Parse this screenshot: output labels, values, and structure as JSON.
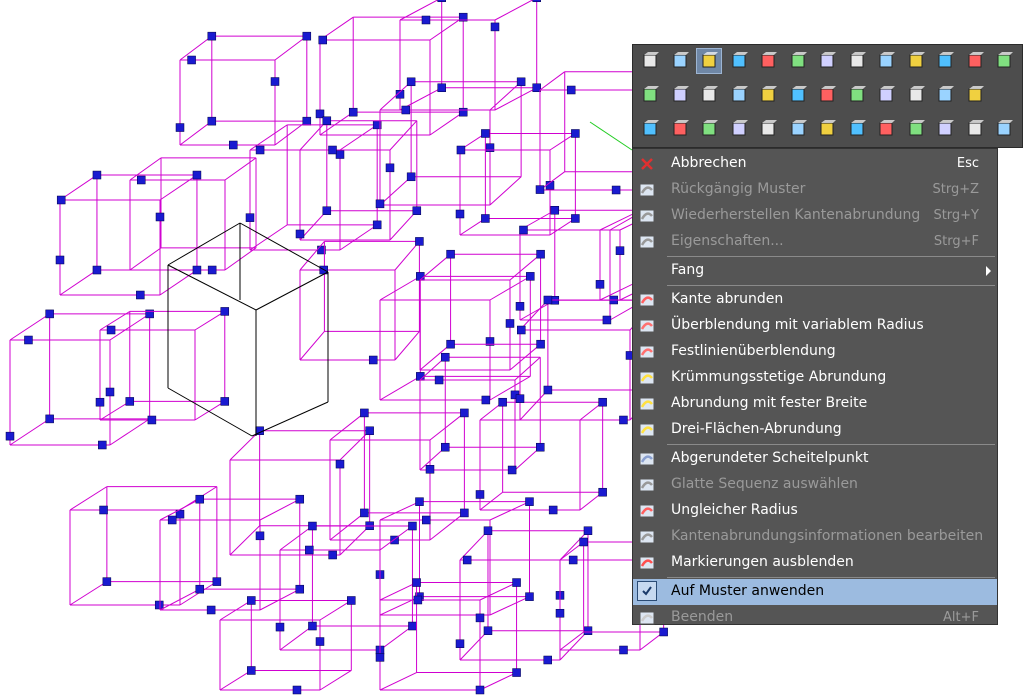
{
  "viewport": {
    "wire_color": "#d000d0",
    "handle_color": "#1a1ad0",
    "highlight_color": "#000000"
  },
  "toolbar": {
    "rows": [
      [
        "select-arrow-icon",
        "select-pick-icon",
        "hidden-line-icon",
        "shaded-icon",
        "shaded-edges-icon",
        "render-icon",
        "perspective-icon",
        "inspect-icon",
        "check-icon",
        "camera-icon",
        "cut-icon",
        "copy-icon",
        "paste-icon"
      ],
      [
        "view-iso-icon",
        "view-front-icon",
        "view-top-icon",
        "view-right-icon",
        "view-back-icon",
        "view-left-icon",
        "view-bottom-icon",
        "view-3d-icon",
        "view-3d-alt-icon",
        "section-icon",
        "rgb-axis-icon",
        "normal-icon"
      ],
      [
        "fillet-star-icon",
        "dimension-icon",
        "grid-icon",
        "axis-icon",
        "snap-box-icon",
        "sweep-icon",
        "curve-icon",
        "solid-icon",
        "edge-icon",
        "face-icon",
        "paint-icon",
        "pointer-tool-icon",
        "move-tool-icon"
      ]
    ]
  },
  "context_menu": {
    "items": [
      {
        "label": "Abbrechen",
        "shortcut": "Esc",
        "icon": "cancel-x-icon",
        "disabled": false
      },
      {
        "label": "Rückgängig Muster",
        "shortcut": "Strg+Z",
        "icon": "undo-icon",
        "disabled": true
      },
      {
        "label": "Wiederherstellen Kantenabrundung",
        "shortcut": "Strg+Y",
        "icon": "redo-icon",
        "disabled": true
      },
      {
        "label": "Eigenschaften...",
        "shortcut": "Strg+F",
        "icon": "properties-icon",
        "disabled": true
      },
      {
        "label": "Fang",
        "shortcut": "",
        "icon": "",
        "disabled": false,
        "submenu": true
      },
      {
        "label": "Kante abrunden",
        "shortcut": "",
        "icon": "edge-fillet-icon",
        "disabled": false
      },
      {
        "label": "Überblendung mit variablem Radius",
        "shortcut": "",
        "icon": "variable-blend-icon",
        "disabled": false
      },
      {
        "label": "Festlinienüberblendung",
        "shortcut": "",
        "icon": "holdline-blend-icon",
        "disabled": false
      },
      {
        "label": "Krümmungsstetige Abrundung",
        "shortcut": "",
        "icon": "curvature-fillet-icon",
        "disabled": false
      },
      {
        "label": "Abrundung mit fester Breite",
        "shortcut": "",
        "icon": "fixed-width-fillet-icon",
        "disabled": false
      },
      {
        "label": "Drei-Flächen-Abrundung",
        "shortcut": "",
        "icon": "three-face-fillet-icon",
        "disabled": false
      },
      {
        "label": "Abgerundeter Scheitelpunkt",
        "shortcut": "",
        "icon": "rounded-vertex-icon",
        "disabled": false
      },
      {
        "label": "Glatte Sequenz auswählen",
        "shortcut": "",
        "icon": "smooth-sequence-icon",
        "disabled": true
      },
      {
        "label": "Ungleicher Radius",
        "shortcut": "",
        "icon": "unequal-radius-icon",
        "disabled": false
      },
      {
        "label": "Kantenabrundungsinformationen bearbeiten",
        "shortcut": "",
        "icon": "edit-fillet-info-icon",
        "disabled": true
      },
      {
        "label": "Markierungen ausblenden",
        "shortcut": "",
        "icon": "hide-marks-icon",
        "disabled": false
      },
      {
        "label": "Auf Muster anwenden",
        "shortcut": "",
        "icon": "check-icon",
        "disabled": false,
        "checked": true
      },
      {
        "label": "Beenden",
        "shortcut": "Alt+F",
        "icon": "finish-flag-icon",
        "disabled": true
      }
    ]
  }
}
